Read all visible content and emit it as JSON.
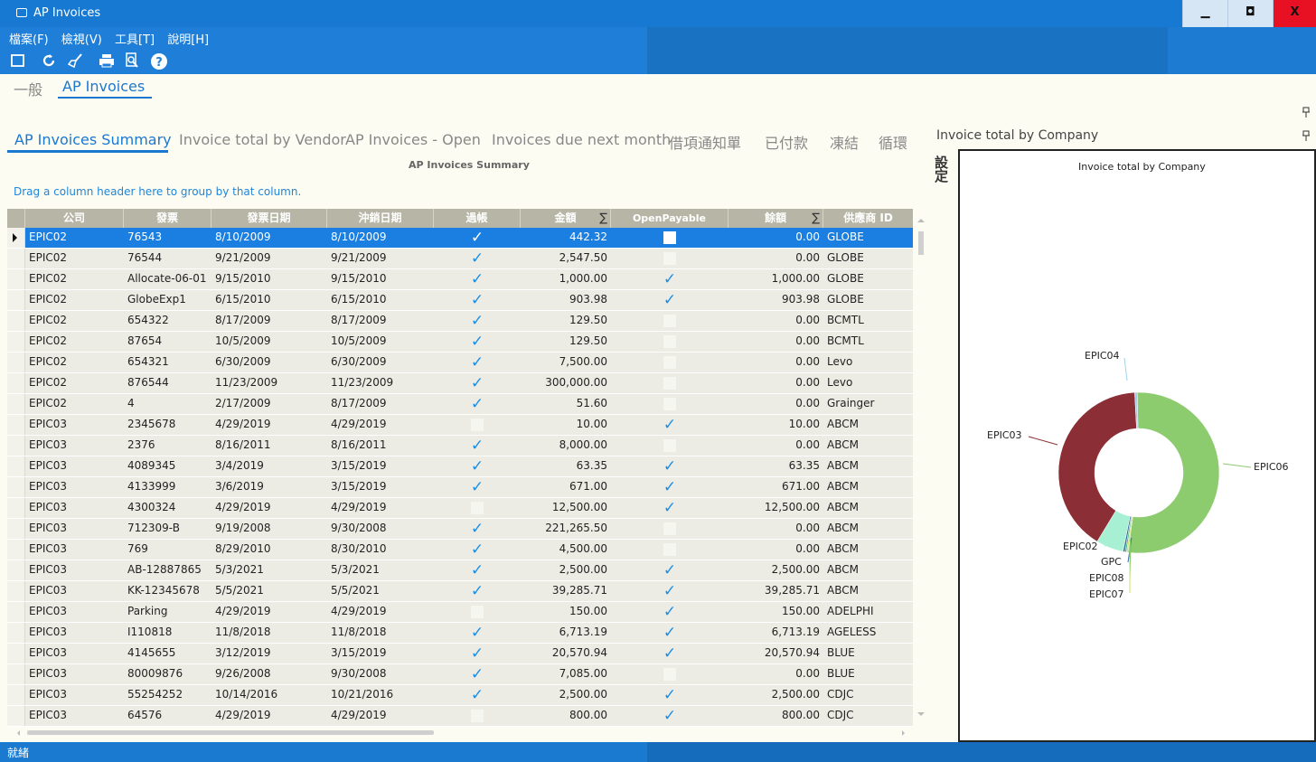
{
  "window": {
    "title": "AP Invoices"
  },
  "menu": [
    "檔案(F)",
    "檢視(V)",
    "工具[T]",
    "說明[H]"
  ],
  "main_tabs": [
    "一般",
    "AP Invoices"
  ],
  "sub_tabs": [
    "AP Invoices Summary",
    "Invoice total by Vendor",
    "AP Invoices - Open",
    "Invoices due next month",
    "借項通知單",
    "已付款",
    "凍結",
    "循環"
  ],
  "grid": {
    "caption": "AP Invoices Summary",
    "group_hint": "Drag a column header here to group by that column.",
    "columns": [
      "公司",
      "發票",
      "發票日期",
      "沖銷日期",
      "過帳",
      "金額",
      "OpenPayable",
      "餘額",
      "供應商 ID"
    ],
    "rows": [
      [
        "EPIC02",
        "76543",
        "8/10/2009",
        "8/10/2009",
        true,
        "442.32",
        false,
        "0.00",
        "GLOBE"
      ],
      [
        "EPIC02",
        "76544",
        "9/21/2009",
        "9/21/2009",
        true,
        "2,547.50",
        false,
        "0.00",
        "GLOBE"
      ],
      [
        "EPIC02",
        "Allocate-06-01",
        "9/15/2010",
        "9/15/2010",
        true,
        "1,000.00",
        true,
        "1,000.00",
        "GLOBE"
      ],
      [
        "EPIC02",
        "GlobeExp1",
        "6/15/2010",
        "6/15/2010",
        true,
        "903.98",
        true,
        "903.98",
        "GLOBE"
      ],
      [
        "EPIC02",
        "654322",
        "8/17/2009",
        "8/17/2009",
        true,
        "129.50",
        false,
        "0.00",
        "BCMTL"
      ],
      [
        "EPIC02",
        "87654",
        "10/5/2009",
        "10/5/2009",
        true,
        "129.50",
        false,
        "0.00",
        "BCMTL"
      ],
      [
        "EPIC02",
        "654321",
        "6/30/2009",
        "6/30/2009",
        true,
        "7,500.00",
        false,
        "0.00",
        "Levo"
      ],
      [
        "EPIC02",
        "876544",
        "11/23/2009",
        "11/23/2009",
        true,
        "300,000.00",
        false,
        "0.00",
        "Levo"
      ],
      [
        "EPIC02",
        "4",
        "2/17/2009",
        "8/17/2009",
        true,
        "51.60",
        false,
        "0.00",
        "Grainger"
      ],
      [
        "EPIC03",
        "2345678",
        "4/29/2019",
        "4/29/2019",
        false,
        "10.00",
        true,
        "10.00",
        "ABCM"
      ],
      [
        "EPIC03",
        "2376",
        "8/16/2011",
        "8/16/2011",
        true,
        "8,000.00",
        false,
        "0.00",
        "ABCM"
      ],
      [
        "EPIC03",
        "4089345",
        "3/4/2019",
        "3/15/2019",
        true,
        "63.35",
        true,
        "63.35",
        "ABCM"
      ],
      [
        "EPIC03",
        "4133999",
        "3/6/2019",
        "3/15/2019",
        true,
        "671.00",
        true,
        "671.00",
        "ABCM"
      ],
      [
        "EPIC03",
        "4300324",
        "4/29/2019",
        "4/29/2019",
        false,
        "12,500.00",
        true,
        "12,500.00",
        "ABCM"
      ],
      [
        "EPIC03",
        "712309-B",
        "9/19/2008",
        "9/30/2008",
        true,
        "221,265.50",
        false,
        "0.00",
        "ABCM"
      ],
      [
        "EPIC03",
        "769",
        "8/29/2010",
        "8/30/2010",
        true,
        "4,500.00",
        false,
        "0.00",
        "ABCM"
      ],
      [
        "EPIC03",
        "AB-12887865",
        "5/3/2021",
        "5/3/2021",
        true,
        "2,500.00",
        true,
        "2,500.00",
        "ABCM"
      ],
      [
        "EPIC03",
        "KK-12345678",
        "5/5/2021",
        "5/5/2021",
        true,
        "39,285.71",
        true,
        "39,285.71",
        "ABCM"
      ],
      [
        "EPIC03",
        "Parking",
        "4/29/2019",
        "4/29/2019",
        false,
        "150.00",
        true,
        "150.00",
        "ADELPHI"
      ],
      [
        "EPIC03",
        "I110818",
        "11/8/2018",
        "11/8/2018",
        true,
        "6,713.19",
        true,
        "6,713.19",
        "AGELESS"
      ],
      [
        "EPIC03",
        "4145655",
        "3/12/2019",
        "3/15/2019",
        true,
        "20,570.94",
        true,
        "20,570.94",
        "BLUE"
      ],
      [
        "EPIC03",
        "80009876",
        "9/26/2008",
        "9/30/2008",
        true,
        "7,085.00",
        false,
        "0.00",
        "BLUE"
      ],
      [
        "EPIC03",
        "55254252",
        "10/14/2016",
        "10/21/2016",
        true,
        "2,500.00",
        true,
        "2,500.00",
        "CDJC"
      ],
      [
        "EPIC03",
        "64576",
        "4/29/2019",
        "4/29/2019",
        false,
        "800.00",
        true,
        "800.00",
        "CDJC"
      ]
    ]
  },
  "settings_label": "設定",
  "chart_panel_title": "Invoice total by Company",
  "chart_data": {
    "type": "pie",
    "title": "Invoice total by Company",
    "slices": [
      {
        "label": "EPIC06",
        "value": 52.5,
        "color": "#8ccc6e"
      },
      {
        "label": "EPIC07",
        "value": 0.3,
        "color": "#c8e06a"
      },
      {
        "label": "EPIC08",
        "value": 0.3,
        "color": "#3fb86b"
      },
      {
        "label": "GPC",
        "value": 0.4,
        "color": "#3a6ea5"
      },
      {
        "label": "EPIC02",
        "value": 5.5,
        "color": "#a8f0d4"
      },
      {
        "label": "EPIC03",
        "value": 40.5,
        "color": "#8b2e35"
      },
      {
        "label": "EPIC04",
        "value": 0.5,
        "color": "#9fd0ea"
      }
    ]
  },
  "status": "就緒"
}
